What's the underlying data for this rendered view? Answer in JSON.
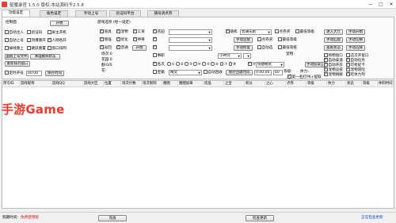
{
  "window": {
    "title": "驱魔录官 1.5.0  版权:本站源码予2.5.8",
    "minimize": "—",
    "maximize": "□",
    "close": "✕"
  },
  "tabs": [
    "功能设定",
    "角色设定",
    "手动上号",
    "验证码平台",
    "捕号请点券"
  ],
  "control": {
    "section_label": "控制面",
    "start_button": "开始",
    "checkboxes": [
      "自动注入",
      "验证码",
      "屏主开机",
      "自动上号",
      "顶爆重开",
      "人网各开",
      "掉线重上",
      "跳跃重置",
      "窗口排列"
    ],
    "btn_add_account": "面据上号文件",
    "btn_clear_status": "清理删除状态",
    "btn_rearrange": "重新排列窗口",
    "timer_label": "定时开号",
    "timer_value": "00:00",
    "btn_save_time": "保存时间"
  },
  "task": {
    "label": "游戏选项 (经一设定)",
    "checks_row1": [
      "道具",
      "宠物",
      "工资"
    ],
    "checks_row2": [
      "增强",
      "优化",
      "神奇"
    ],
    "checks_row3": [
      "返回",
      "普通",
      "开始"
    ],
    "field_labels": [
      "场次:0",
      "花园:0",
      "翻:0/0",
      "花:"
    ]
  },
  "middle": {
    "garden_label": "花园",
    "row2_label": "",
    "row3_label": "",
    "row4_label": "事职",
    "combo_small": "小神剑",
    "combo_small2": "无",
    "count_label": "计数",
    "choices_label": "名次",
    "radios": [
      "①",
      "②",
      "③",
      "④",
      "⑤",
      "⑥",
      "⑦",
      "⑧",
      "⑨",
      "⑩"
    ],
    "shop_label": "宝箱",
    "shop_combo": "精灵",
    "auto_recycle": "自动回收",
    "btn_save_recycle": "保存回收时间",
    "time_value": "0:00:00",
    "timer2": "60"
  },
  "right": {
    "auto_combo_label": "随机",
    "auto_combo": "普通先跑",
    "points_buy": "点券买",
    "min_grade": "最低等级",
    "btn_manual_connect": "手动连接",
    "btn_manual_fix": "手动修复",
    "checks_a": [
      "点券买",
      "自动选"
    ],
    "min_label": "最低等级",
    "pet_label": "宠物:",
    "mode_combo": "快捷模式",
    "level_label": "等级:",
    "stamina_label": "体力:",
    "btn_manual_run": "手动跳跃",
    "btn_manual_close": "手动提取",
    "check_first": "第一名打PK+提取",
    "col2_buttons": [
      "进入大厅",
      "手动匹配"
    ],
    "col2_buttons_b": [
      "手动开始",
      "手动切换"
    ],
    "col3_checks": [
      "购物窗口",
      "自动拿道",
      "自动开房",
      "宠物竞技",
      "宠物捐献"
    ],
    "col4_checks": [
      "这次开窗口",
      "自动任务",
      "可抢捉卡",
      "宠物冒险",
      "吃体力剂"
    ],
    "btn_view_status": "查看状态",
    "btn_manual_select": "手动选择"
  },
  "table": {
    "columns": [
      "序号ID",
      "游戏昵称",
      "游戏QQ",
      "游戏大区",
      "位置",
      "场次计数",
      "场次限制",
      "圈圈",
      "圈圈加章",
      "结晶",
      "之宝",
      "积分",
      "之心",
      "点券",
      "等级",
      "体力",
      "状态",
      "等级",
      "体制时间"
    ]
  },
  "watermark": "手游Game",
  "status": {
    "expire_label": "到期时间:",
    "expire_value": "免费使用版",
    "btn_recharge": "充值",
    "btn_check_update": "检查更新",
    "online_text": "正在检查更新"
  }
}
